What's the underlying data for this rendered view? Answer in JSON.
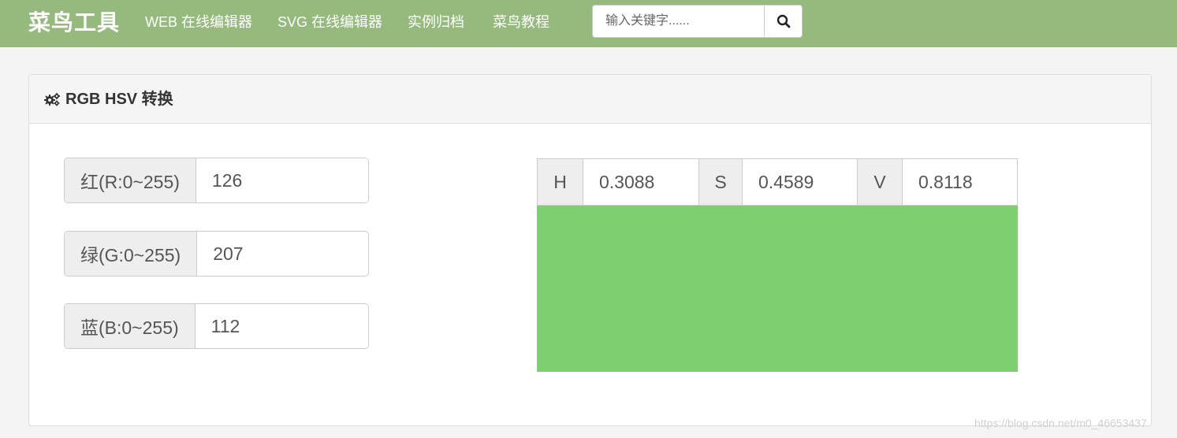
{
  "navbar": {
    "brand": "菜鸟工具",
    "links": [
      {
        "label": "WEB 在线编辑器"
      },
      {
        "label": "SVG 在线编辑器"
      },
      {
        "label": "实例归档"
      },
      {
        "label": "菜鸟教程"
      }
    ],
    "search": {
      "placeholder": "输入关键字......",
      "value": "",
      "button_icon": "search-icon"
    },
    "background_color": "#96b97d"
  },
  "panel": {
    "title_icon": "cogs-icon",
    "title": "RGB HSV 转换",
    "rgb": [
      {
        "label": "红(R:0~255)",
        "value": "126"
      },
      {
        "label": "绿(G:0~255)",
        "value": "207"
      },
      {
        "label": "蓝(B:0~255)",
        "value": "112"
      }
    ],
    "hsv": [
      {
        "label": "H",
        "value": "0.3088"
      },
      {
        "label": "S",
        "value": "0.4589"
      },
      {
        "label": "V",
        "value": "0.8118"
      }
    ],
    "preview_color": "#7ecf70"
  },
  "watermark": "https://blog.csdn.net/m0_46653437"
}
